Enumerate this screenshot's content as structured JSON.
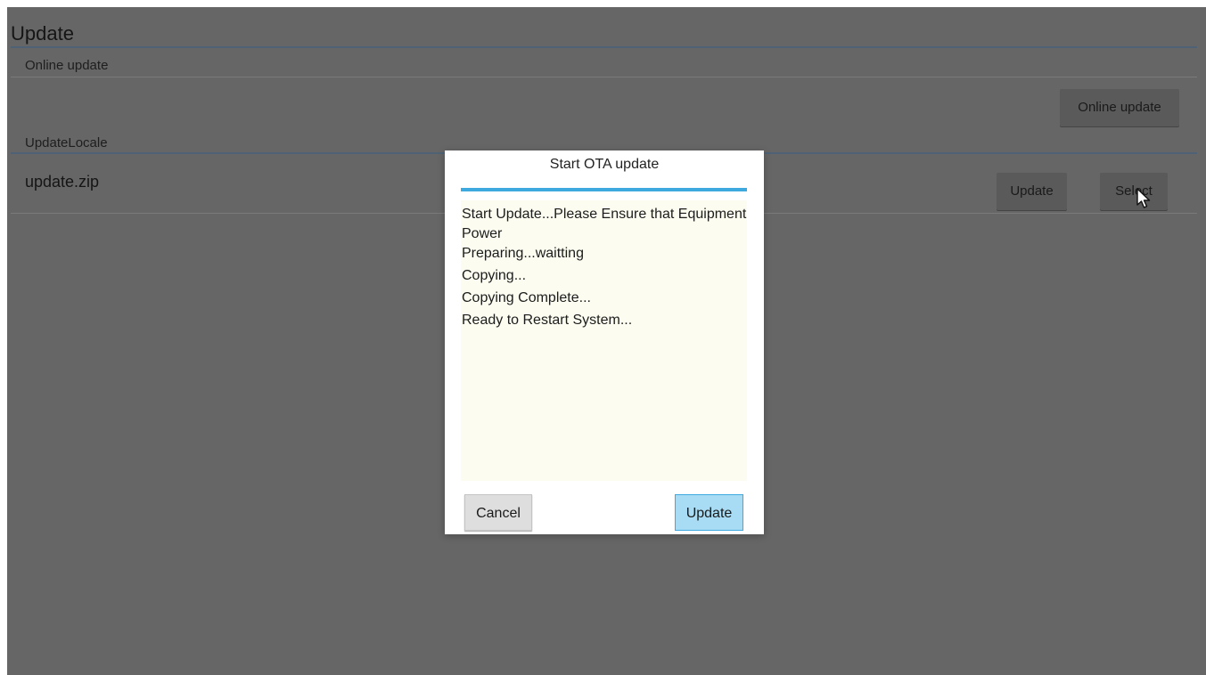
{
  "page": {
    "title": "Update"
  },
  "online_section": {
    "label": "Online update",
    "button_label": "Online update"
  },
  "local_section": {
    "label": "UpdateLocale",
    "file_name": "update.zip",
    "update_button_label": "Update",
    "select_button_label": "Select"
  },
  "dialog": {
    "title": "Start OTA update",
    "log_lines": [
      "Start Update...Please Ensure that Equipment Power",
      "Preparing...waitting",
      "Copying...",
      "Copying Complete...",
      "Ready to Restart System..."
    ],
    "cancel_label": "Cancel",
    "update_label": "Update"
  },
  "colors": {
    "accent": "#3ea9de",
    "overlay": "#666666",
    "log_background": "#fcfdf0",
    "primary_button": "#a8dcf4"
  },
  "icons": {
    "cursor": "mouse-pointer-icon"
  }
}
